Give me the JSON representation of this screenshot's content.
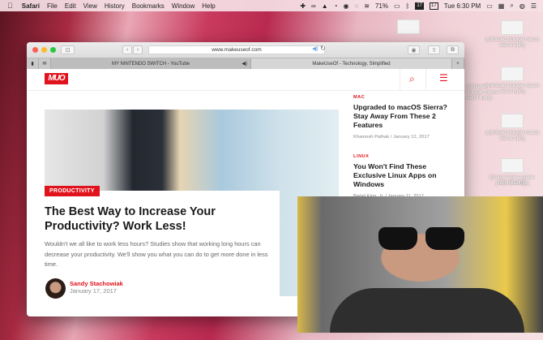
{
  "menubar": {
    "apple": "",
    "app": "Safari",
    "items": [
      "File",
      "Edit",
      "View",
      "History",
      "Bookmarks",
      "Window",
      "Help"
    ],
    "battery": "71%",
    "cal1": "17",
    "cal2": "17",
    "clock": "Tue 6:30 PM"
  },
  "desktop": {
    "icons": [
      "optimized storage macos sierra 5.png",
      "optimized storage macos sierra 4.png",
      "optimized storage macos sierra 6.png",
      "optimized storage macos sierra 3.png",
      "iphone-7-plus-space-gray-...desk.jpg",
      "image...png"
    ]
  },
  "browser": {
    "url": "www.makeuseof.com",
    "tabs": [
      {
        "label": "MY NINTENDO SWITCH - YouTube",
        "active": false
      },
      {
        "label": "MakeUseOf - Technology, Simplified",
        "active": true
      }
    ],
    "new_tab": "+"
  },
  "site": {
    "logo": "MUO",
    "featured": {
      "tag": "PRODUCTIVITY",
      "title": "The Best Way to Increase Your Productivity? Work Less!",
      "excerpt": "Wouldn't we all like to work less hours? Studies show that working long hours can decrease your productivity. We'll show you what you can do to get more done in less time.",
      "author": "Sandy Stachowiak",
      "date": "January 17, 2017"
    },
    "sidebar": [
      {
        "category": "MAC",
        "title": "Upgraded to macOS Sierra? Stay Away From These 2 Features",
        "meta": "Khamosh Pathak  /  January 12, 2017"
      },
      {
        "category": "LINUX",
        "title": "You Won't Find These Exclusive Linux Apps on Windows",
        "meta": "Bertel King, Jr.  /  January 11, 2017"
      }
    ]
  },
  "colors": {
    "accent": "#e0121b"
  }
}
